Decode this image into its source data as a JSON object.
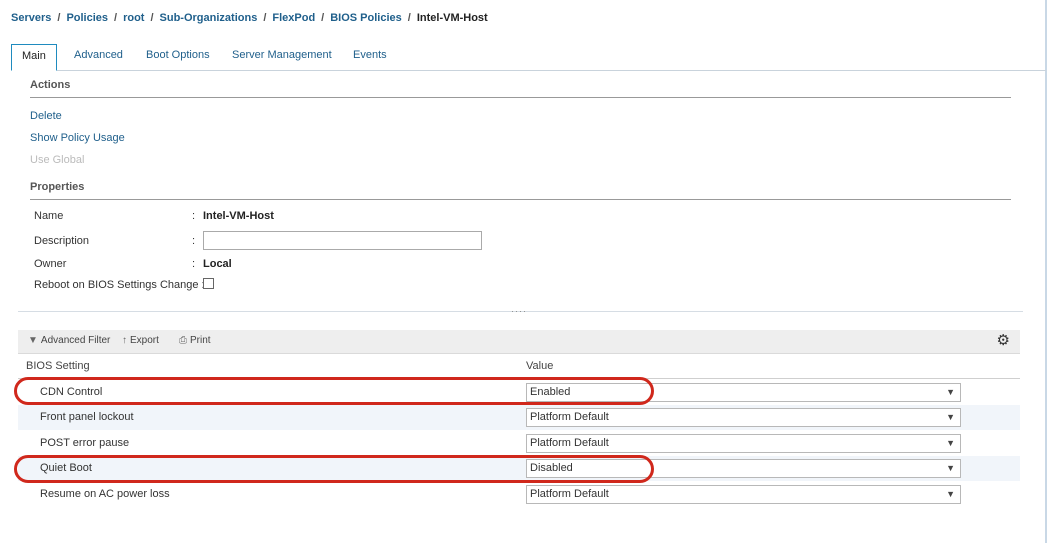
{
  "breadcrumb": {
    "items": [
      "Servers",
      "Policies",
      "root",
      "Sub-Organizations",
      "FlexPod",
      "BIOS Policies"
    ],
    "current": "Intel-VM-Host",
    "separator": "/"
  },
  "tabs": [
    {
      "label": "Main",
      "active": true
    },
    {
      "label": "Advanced",
      "active": false
    },
    {
      "label": "Boot Options",
      "active": false
    },
    {
      "label": "Server Management",
      "active": false
    },
    {
      "label": "Events",
      "active": false
    }
  ],
  "actions": {
    "title": "Actions",
    "delete": "Delete",
    "show_policy_usage": "Show Policy Usage",
    "use_global": "Use Global"
  },
  "properties": {
    "title": "Properties",
    "name_label": "Name",
    "name_value": "Intel-VM-Host",
    "description_label": "Description",
    "description_value": "",
    "owner_label": "Owner",
    "owner_value": "Local",
    "reboot_label": "Reboot on BIOS Settings Change :",
    "reboot_checked": false,
    "colon": ":"
  },
  "toolbar": {
    "advanced_filter": "Advanced Filter",
    "export": "Export",
    "print": "Print"
  },
  "table": {
    "col_setting": "BIOS Setting",
    "col_value": "Value",
    "rows": [
      {
        "setting": "CDN Control",
        "value": "Enabled",
        "highlighted": true
      },
      {
        "setting": "Front panel lockout",
        "value": "Platform Default",
        "highlighted": false
      },
      {
        "setting": "POST error pause",
        "value": "Platform Default",
        "highlighted": false
      },
      {
        "setting": "Quiet Boot",
        "value": "Disabled",
        "highlighted": true
      },
      {
        "setting": "Resume on AC power loss",
        "value": "Platform Default",
        "highlighted": false
      }
    ]
  },
  "colors": {
    "link": "#1f5f8b",
    "highlight": "#d0281c",
    "alt_row": "#f1f5fa"
  }
}
